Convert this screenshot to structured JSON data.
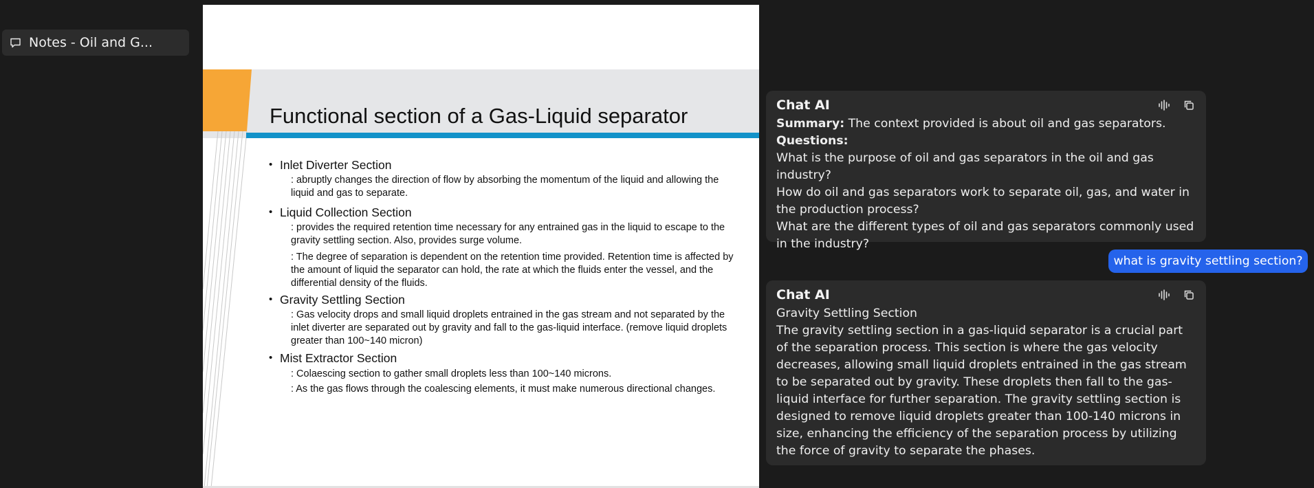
{
  "sidebar": {
    "note_title": "Notes - Oil and G..."
  },
  "slide": {
    "title": "Functional section of a Gas-Liquid separator",
    "sections": [
      {
        "heading": "Inlet Diverter Section",
        "details": [
          ": abruptly changes the direction of flow by absorbing the momentum of the liquid and allowing the liquid and gas to separate."
        ]
      },
      {
        "heading": "Liquid Collection Section",
        "details": [
          ": provides the required retention time necessary for any entrained gas in the liquid to escape to the gravity settling section. Also, provides surge volume.",
          ": The degree of separation is dependent on the retention time provided. Retention time is affected by the amount of liquid the separator can hold, the rate at which the fluids enter the vessel, and the differential density of the fluids."
        ]
      },
      {
        "heading": "Gravity Settling Section",
        "details": [
          ": Gas velocity drops and small liquid droplets entrained in the gas stream and not separated by the inlet diverter are separated out by gravity and fall to the  gas-liquid interface. (remove liquid droplets greater than 100~140 micron)"
        ]
      },
      {
        "heading": "Mist Extractor Section",
        "details": [
          ": Colaescing section to gather small droplets less than 100~140 microns.",
          ": As the gas flows through the coalescing elements, it must make numerous directional changes."
        ]
      }
    ]
  },
  "chat": {
    "messages": [
      {
        "sender": "Chat AI",
        "summary_label": "Summary:",
        "summary_text": " The context provided is about oil and gas separators.",
        "questions_label": "Questions:",
        "questions": [
          "What is the purpose of oil and gas separators in the oil and gas industry?",
          "How do oil and gas separators work to separate oil, gas, and water in the production process?",
          "What are the different types of oil and gas separators commonly used in the industry?"
        ]
      },
      {
        "sender": "user",
        "text": "what is gravity settling section?"
      },
      {
        "sender": "Chat AI",
        "heading": "Gravity Settling Section",
        "text": "The gravity settling section in a gas-liquid separator is a crucial part of the separation process. This section is where the gas velocity decreases, allowing small liquid droplets entrained in the gas stream to be separated out by gravity. These droplets then fall to the gas-liquid interface for further separation. The gravity settling section is designed to remove liquid droplets greater than 100-140 microns in size, enhancing the efficiency of the separation process by utilizing the force of gravity to separate the phases."
      }
    ],
    "icons": {
      "speak": "audio-wave-icon",
      "copy": "copy-icon"
    }
  },
  "colors": {
    "background": "#1b1b1b",
    "card": "#2b2b2b",
    "user_bubble": "#2563eb",
    "slide_orange": "#f6a636",
    "slide_blue": "#1292c9"
  }
}
